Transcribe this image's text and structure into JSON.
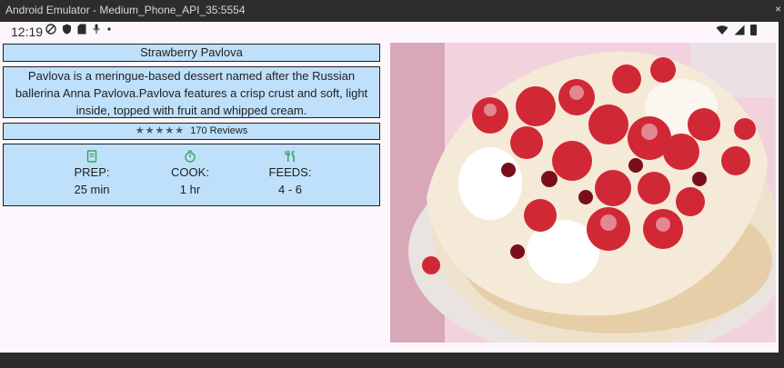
{
  "window": {
    "title": "Android Emulator - Medium_Phone_API_35:5554",
    "close_glyph": "×"
  },
  "status_bar": {
    "time": "12:19"
  },
  "recipe": {
    "title": "Strawberry Pavlova",
    "description": "Pavlova is a meringue-based dessert named after the Russian ballerina Anna Pavlova.Pavlova features a crisp crust and soft, light inside, topped with fruit and whipped cream.",
    "stars": "★★★★★",
    "reviews": "170 Reviews",
    "info": [
      {
        "icon": "book-icon",
        "label": "PREP:",
        "value": "25 min"
      },
      {
        "icon": "timer-icon",
        "label": "COOK:",
        "value": "1 hr"
      },
      {
        "icon": "cutlery-icon",
        "label": "FEEDS:",
        "value": "4 - 6"
      }
    ]
  },
  "colors": {
    "card_bg": "#bfe0fb",
    "accent_icon": "#3aa55a",
    "screen_bg": "#fdf6fc"
  }
}
